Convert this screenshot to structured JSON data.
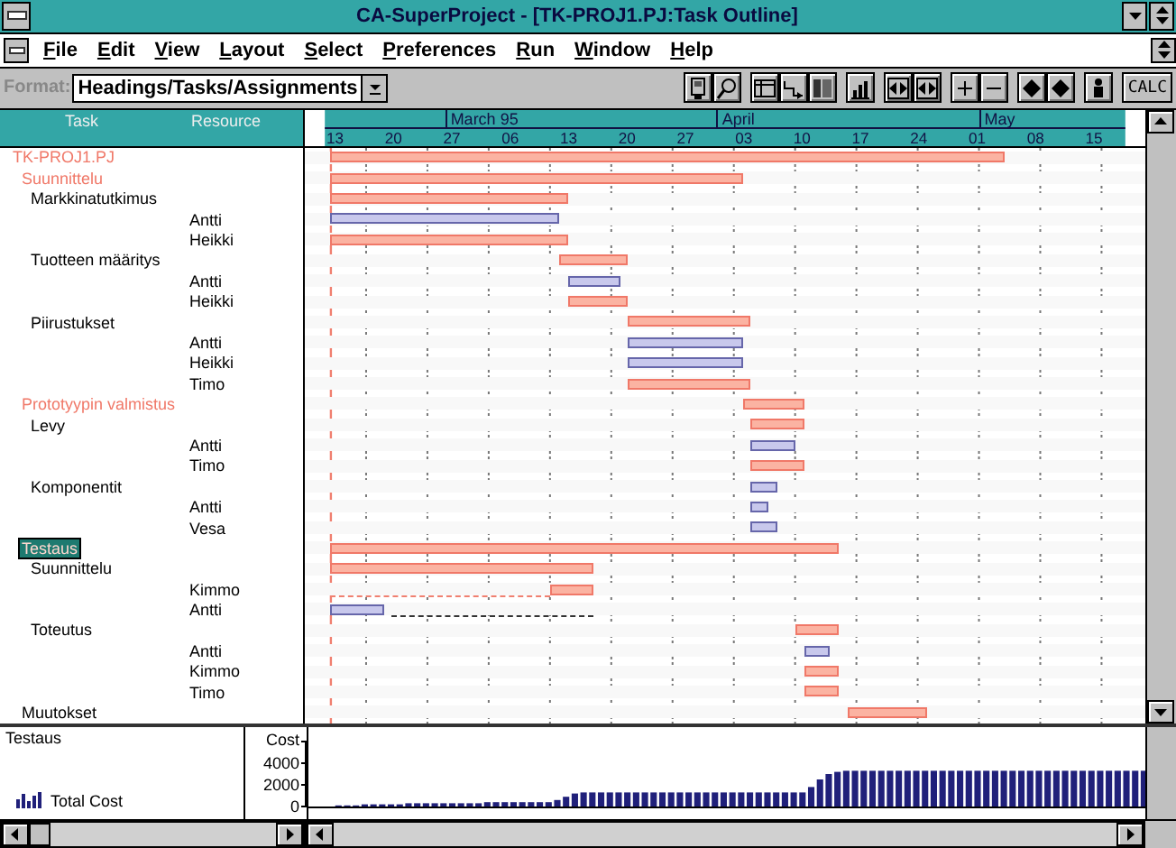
{
  "window": {
    "title": "CA-SuperProject - [TK-PROJ1.PJ:Task Outline]"
  },
  "menu_bar": [
    "File",
    "Edit",
    "View",
    "Layout",
    "Select",
    "Preferences",
    "Run",
    "Window",
    "Help"
  ],
  "toolbar": {
    "format_label": "Format:",
    "format_value": "Headings/Tasks/Assignments",
    "calc_button": "CALC"
  },
  "timeline": {
    "weeks": [
      "13",
      "20",
      "27",
      "06",
      "13",
      "20",
      "27",
      "03",
      "10",
      "17",
      "24",
      "01",
      "08",
      "15"
    ],
    "months": [
      {
        "label": "March 95",
        "start": {
          "level": 0.167
        }
      },
      {
        "label": "April",
        "start": {
          "level": 0.49
        }
      },
      {
        "label": "May",
        "start": {
          "level": 0.802
        }
      }
    ]
  },
  "outline": {
    "columns": [
      "Task",
      "Resource"
    ],
    "items": [
      {
        "name": "TK-PROJ1.PJ",
        "kind": "project",
        "selected": false,
        "bar": {
          "kind": "critical",
          "start": {
            "level": 0.031
          },
          "end": {
            "level": 0.833
          }
        },
        "children": [
          {
            "name": "Suunnittelu",
            "kind": "summary",
            "selected": false,
            "bar": {
              "kind": "critical",
              "start": {
                "level": 0.031
              },
              "end": {
                "level": 0.521
              }
            },
            "children": [
              {
                "name": "Markkinatutkimus",
                "kind": "task",
                "selected": false,
                "bar": {
                  "kind": "critical",
                  "start": {
                    "level": 0.031
                  },
                  "end": {
                    "level": 0.313
                  }
                },
                "assignments": [
                  {
                    "resource": "Antti",
                    "bar": {
                      "kind": "normal",
                      "start": {
                        "level": 0.031
                      },
                      "end": {
                        "level": 0.302
                      }
                    }
                  },
                  {
                    "resource": "Heikki",
                    "bar": {
                      "kind": "critical",
                      "start": {
                        "level": 0.031
                      },
                      "end": {
                        "level": 0.313
                      }
                    }
                  }
                ]
              },
              {
                "name": "Tuotteen määritys",
                "kind": "task",
                "selected": false,
                "bar": {
                  "kind": "critical",
                  "start": {
                    "level": 0.302
                  },
                  "end": {
                    "level": 0.385
                  }
                },
                "assignments": [
                  {
                    "resource": "Antti",
                    "bar": {
                      "kind": "normal",
                      "start": {
                        "level": 0.313
                      },
                      "end": {
                        "level": 0.375
                      }
                    }
                  },
                  {
                    "resource": "Heikki",
                    "bar": {
                      "kind": "critical",
                      "start": {
                        "level": 0.313
                      },
                      "end": {
                        "level": 0.385
                      }
                    }
                  }
                ]
              },
              {
                "name": "Piirustukset",
                "kind": "task",
                "selected": false,
                "bar": {
                  "kind": "critical",
                  "start": {
                    "level": 0.385
                  },
                  "end": {
                    "level": 0.531
                  }
                },
                "assignments": [
                  {
                    "resource": "Antti",
                    "bar": {
                      "kind": "normal",
                      "start": {
                        "level": 0.385
                      },
                      "end": {
                        "level": 0.521
                      }
                    }
                  },
                  {
                    "resource": "Heikki",
                    "bar": {
                      "kind": "normal",
                      "start": {
                        "level": 0.385
                      },
                      "end": {
                        "level": 0.521
                      }
                    }
                  },
                  {
                    "resource": "Timo",
                    "bar": {
                      "kind": "critical",
                      "start": {
                        "level": 0.385
                      },
                      "end": {
                        "level": 0.531
                      }
                    }
                  }
                ]
              }
            ]
          },
          {
            "name": "Prototyypin valmistus",
            "kind": "summary",
            "selected": false,
            "bar": {
              "kind": "critical",
              "start": {
                "level": 0.521
              },
              "end": {
                "level": 0.594
              }
            },
            "children": [
              {
                "name": "Levy",
                "kind": "task",
                "selected": false,
                "bar": {
                  "kind": "critical",
                  "start": {
                    "level": 0.531
                  },
                  "end": {
                    "level": 0.594
                  }
                },
                "assignments": [
                  {
                    "resource": "Antti",
                    "bar": {
                      "kind": "normal",
                      "start": {
                        "level": 0.531
                      },
                      "end": {
                        "level": 0.583
                      }
                    }
                  },
                  {
                    "resource": "Timo",
                    "bar": {
                      "kind": "critical",
                      "start": {
                        "level": 0.531
                      },
                      "end": {
                        "level": 0.594
                      }
                    }
                  }
                ]
              },
              {
                "name": "Komponentit",
                "kind": "task",
                "selected": false,
                "bar": {
                  "kind": "normal",
                  "start": {
                    "level": 0.531
                  },
                  "end": {
                    "level": 0.563
                  }
                },
                "assignments": [
                  {
                    "resource": "Antti",
                    "bar": {
                      "kind": "normal",
                      "start": {
                        "level": 0.531
                      },
                      "end": {
                        "level": 0.552
                      }
                    }
                  },
                  {
                    "resource": "Vesa",
                    "bar": {
                      "kind": "normal",
                      "start": {
                        "level": 0.531
                      },
                      "end": {
                        "level": 0.563
                      }
                    }
                  }
                ]
              }
            ]
          },
          {
            "name": "Testaus",
            "kind": "summary",
            "selected": true,
            "bar": {
              "kind": "critical",
              "start": {
                "level": 0.031
              },
              "end": {
                "level": 0.635
              }
            },
            "children": [
              {
                "name": "Suunnittelu",
                "kind": "task",
                "selected": false,
                "bar": {
                  "kind": "critical",
                  "start": {
                    "level": 0.031
                  },
                  "end": {
                    "level": 0.344
                  }
                },
                "assignments": [
                  {
                    "resource": "Kimmo",
                    "bar": {
                      "kind": "critical",
                      "start": {
                        "level": 0.292
                      },
                      "end": {
                        "level": 0.344
                      }
                    },
                    "slack": {
                      "start": {
                        "level": 0.031
                      },
                      "end": {
                        "level": 0.292
                      }
                    }
                  },
                  {
                    "resource": "Antti",
                    "bar": {
                      "kind": "normal",
                      "start": {
                        "level": 0.031
                      },
                      "end": {
                        "level": 0.094
                      }
                    },
                    "slack": {
                      "start": {
                        "level": 0.104
                      },
                      "end": {
                        "level": 0.344
                      }
                    }
                  }
                ]
              },
              {
                "name": "Toteutus",
                "kind": "task",
                "selected": false,
                "bar": {
                  "kind": "critical",
                  "start": {
                    "level": 0.583
                  },
                  "end": {
                    "level": 0.635
                  }
                },
                "assignments": [
                  {
                    "resource": "Antti",
                    "bar": {
                      "kind": "normal",
                      "start": {
                        "level": 0.594
                      },
                      "end": {
                        "level": 0.625
                      }
                    }
                  },
                  {
                    "resource": "Kimmo",
                    "bar": {
                      "kind": "critical",
                      "start": {
                        "level": 0.594
                      },
                      "end": {
                        "level": 0.635
                      }
                    }
                  },
                  {
                    "resource": "Timo",
                    "bar": {
                      "kind": "critical",
                      "start": {
                        "level": 0.594
                      },
                      "end": {
                        "level": 0.635
                      }
                    }
                  }
                ]
              }
            ]
          },
          {
            "name": "Muutokset",
            "kind": "task",
            "selected": false,
            "bar": {
              "kind": "critical",
              "start": {
                "level": 0.646
              },
              "end": {
                "level": 0.74
              }
            }
          }
        ]
      }
    ]
  },
  "cost_pane": {
    "task_label": "Testaus",
    "chart_data": {
      "type": "bar",
      "ylabel": "Cost",
      "ylim": [
        0,
        6000
      ],
      "yticks": [
        0,
        2000,
        4000
      ],
      "series": [
        {
          "name": "Total Cost",
          "color": "#20207a",
          "values": [
            null,
            null,
            null,
            100,
            100,
            100,
            200,
            200,
            200,
            200,
            200,
            300,
            300,
            300,
            300,
            300,
            300,
            300,
            300,
            300,
            400,
            400,
            400,
            400,
            400,
            400,
            400,
            400,
            600,
            900,
            1200,
            1300,
            1300,
            1300,
            1300,
            1300,
            1300,
            1300,
            1300,
            1300,
            1300,
            1300,
            1300,
            1300,
            1300,
            1300,
            1300,
            1300,
            1300,
            1300,
            1300,
            1300,
            1300,
            1300,
            1300,
            1300,
            1300,
            1800,
            2500,
            3000,
            3200,
            3300,
            3300,
            3300,
            3300,
            3300,
            3300,
            3300,
            3300,
            3300,
            3300,
            3300,
            3300,
            3300,
            3300,
            3300,
            3300,
            3300,
            3300,
            3300,
            3300,
            3300,
            3300,
            3300,
            3300,
            3300,
            3300,
            3300,
            3300,
            3300,
            3300,
            3300,
            3300,
            3300,
            3300,
            3300
          ]
        }
      ]
    }
  }
}
